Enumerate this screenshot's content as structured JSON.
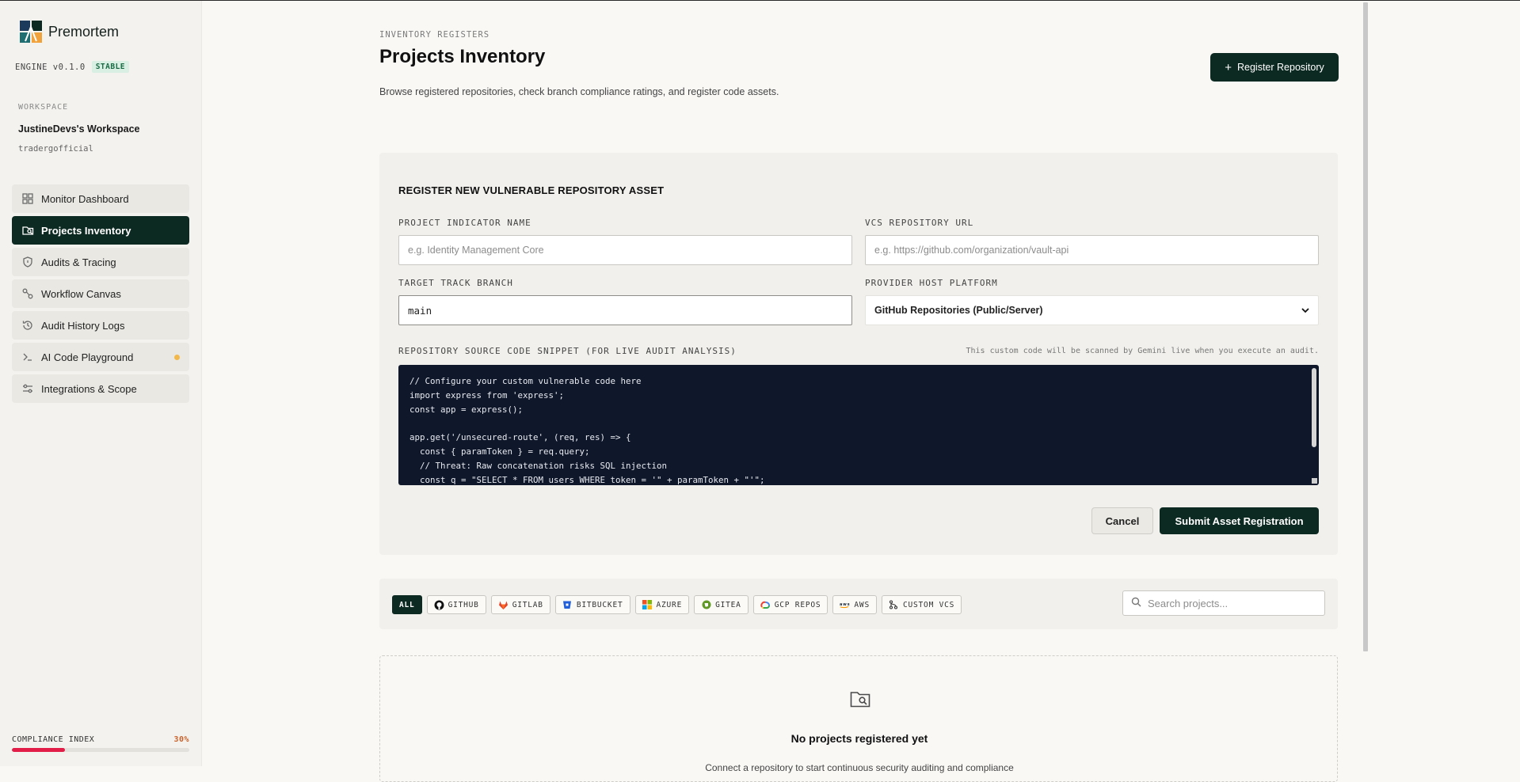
{
  "app": {
    "name": "Premortem",
    "engine_version": "ENGINE v0.1.0",
    "engine_badge": "STABLE"
  },
  "workspace": {
    "label": "WORKSPACE",
    "name": "JustineDevs's Workspace",
    "user": "tradergofficial"
  },
  "sidebar": {
    "items": [
      {
        "label": "Monitor Dashboard",
        "icon": "grid-icon"
      },
      {
        "label": "Projects Inventory",
        "icon": "folder-search-icon",
        "active": true
      },
      {
        "label": "Audits & Tracing",
        "icon": "shield-icon"
      },
      {
        "label": "Workflow Canvas",
        "icon": "nodes-icon"
      },
      {
        "label": "Audit History Logs",
        "icon": "history-icon"
      },
      {
        "label": "AI Code Playground",
        "icon": "terminal-icon",
        "dot_color": "#f2b84b"
      },
      {
        "label": "Integrations & Scope",
        "icon": "sliders-icon"
      }
    ],
    "compliance": {
      "label": "COMPLIANCE INDEX",
      "value_text": "30%",
      "value": 0.3,
      "color": "#e11d48"
    }
  },
  "header": {
    "eyebrow": "INVENTORY REGISTERS",
    "title": "Projects Inventory",
    "subtitle": "Browse registered repositories, check branch compliance ratings, and register code assets.",
    "register_button": "Register Repository"
  },
  "form": {
    "title": "REGISTER NEW VULNERABLE REPOSITORY ASSET",
    "project_name": {
      "label": "PROJECT INDICATOR NAME",
      "placeholder": "e.g. Identity Management Core",
      "value": ""
    },
    "vcs_url": {
      "label": "VCS REPOSITORY URL",
      "placeholder": "e.g. https://github.com/organization/vault-api",
      "value": ""
    },
    "branch": {
      "label": "TARGET TRACK BRANCH",
      "value": "main"
    },
    "provider": {
      "label": "PROVIDER HOST PLATFORM",
      "selected": "GitHub Repositories (Public/Server)"
    },
    "code": {
      "label": "REPOSITORY SOURCE CODE SNIPPET (FOR LIVE AUDIT ANALYSIS)",
      "hint": "This custom code will be scanned by Gemini live when you execute an audit.",
      "content": "// Configure your custom vulnerable code here\nimport express from 'express';\nconst app = express();\n\napp.get('/unsecured-route', (req, res) => {\n  const { paramToken } = req.query;\n  // Threat: Raw concatenation risks SQL injection\n  const q = \"SELECT * FROM users WHERE token = '\" + paramToken + \"'\";"
    },
    "cancel_label": "Cancel",
    "submit_label": "Submit Asset Registration"
  },
  "filters": {
    "items": [
      {
        "label": "ALL",
        "icon": "",
        "active": true
      },
      {
        "label": "GITHUB",
        "icon": "github-icon"
      },
      {
        "label": "GITLAB",
        "icon": "gitlab-icon"
      },
      {
        "label": "BITBUCKET",
        "icon": "bitbucket-icon"
      },
      {
        "label": "AZURE",
        "icon": "azure-icon"
      },
      {
        "label": "GITEA",
        "icon": "gitea-icon"
      },
      {
        "label": "GCP REPOS",
        "icon": "gcp-icon"
      },
      {
        "label": "AWS",
        "icon": "aws-icon"
      },
      {
        "label": "CUSTOM VCS",
        "icon": "git-branch-icon"
      }
    ],
    "search_placeholder": "Search projects..."
  },
  "empty_state": {
    "icon": "folder-search-icon",
    "title": "No projects registered yet",
    "subtitle": "Connect a repository to start continuous security auditing and compliance"
  }
}
